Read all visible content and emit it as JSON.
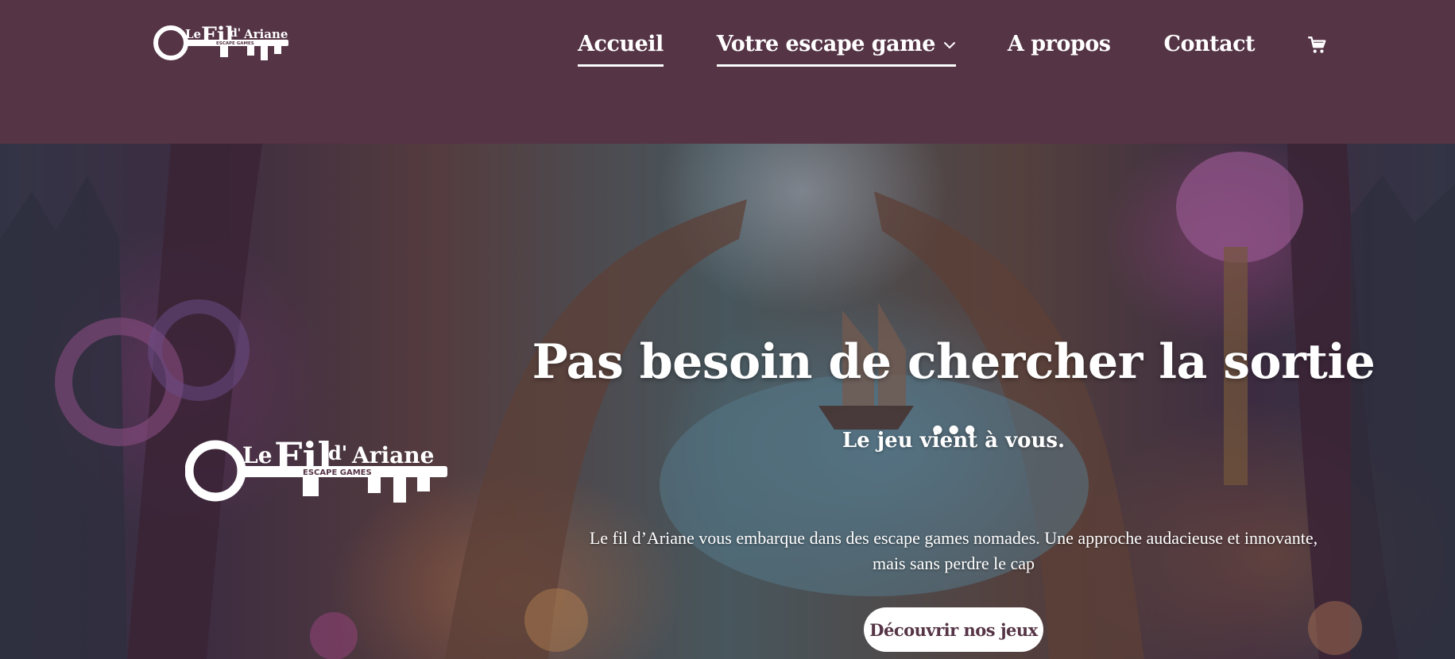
{
  "header": {
    "logo": {
      "icon": "key-icon",
      "text_le": "Le",
      "text_fil": "Fil",
      "text_d": "d'",
      "text_ariane": "Ariane",
      "tagline": "ESCAPE GAMES"
    },
    "nav": {
      "accueil": "Accueil",
      "escape": "Votre escape game",
      "apropos": "A propos",
      "contact": "Contact"
    },
    "cart_icon": "cart-icon"
  },
  "hero": {
    "logo": {
      "text_le": "Le",
      "text_fil": "Fil",
      "text_d": "d'",
      "text_ariane": "Ariane",
      "tagline": "ESCAPE GAMES"
    },
    "title": "Pas besoin de chercher la sortie ...",
    "subtitle": "Le jeu vient à vous.",
    "description": "Le fil d’Ariane vous embarque dans des escape games nomades. Une approche audacieuse et innovante, mais sans perdre le cap",
    "cta": "Découvrir nos jeux"
  },
  "colors": {
    "brand": "#553445",
    "text": "#ffffff"
  }
}
